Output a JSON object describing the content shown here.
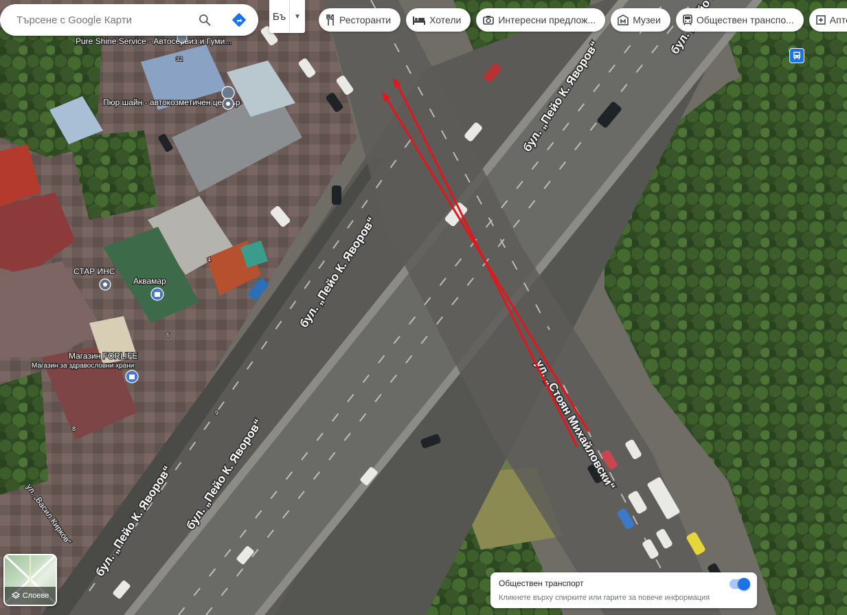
{
  "search": {
    "placeholder": "Търсене с Google Карти"
  },
  "language": {
    "code": "Бъ"
  },
  "chips": [
    {
      "icon": "restaurant-icon",
      "label": "Ресторанти"
    },
    {
      "icon": "hotel-icon",
      "label": "Хотели"
    },
    {
      "icon": "camera-icon",
      "label": "Интересни предлож..."
    },
    {
      "icon": "museum-icon",
      "label": "Музеи"
    },
    {
      "icon": "transit-icon",
      "label": "Обществен транспо..."
    },
    {
      "icon": "pharmacy-icon",
      "label": "Апте"
    }
  ],
  "map": {
    "road_labels": [
      "бул. „Пейо К. Яворов“",
      "бул. „Пейо К. Яворов“",
      "бул. „Пейо К. Яворов“",
      "бул. „Пейо К. Яворов“",
      "бул. „Пейо К. Яворов“",
      "ул. „Стоян Михайловски“",
      "ул. „Васил Кирков“"
    ],
    "places": [
      {
        "name": "Pure Shine Service - Автосервиз и Гуми...",
        "icon": "pin-icon"
      },
      {
        "name": "Пюр шайн - автокозметичен център",
        "icon": "pin-icon"
      },
      {
        "name": "СТАР ИНС",
        "icon": "pin-icon"
      },
      {
        "name": "Аквамар",
        "icon": "shopping-icon"
      },
      {
        "name": "Магазин FORLIFE",
        "sub": "Магазин за здравословни храни",
        "icon": "shopping-icon"
      }
    ],
    "house_numbers": [
      "32",
      "4",
      "6",
      "8",
      "9"
    ],
    "annotation_color": "#e8141b"
  },
  "layers": {
    "label": "Слоеве"
  },
  "transit_card": {
    "title": "Обществен транспорт",
    "subtitle": "Кликнете върху спирките или гарите за повече информация",
    "enabled": true
  },
  "colors": {
    "accent": "#1a73e8"
  }
}
